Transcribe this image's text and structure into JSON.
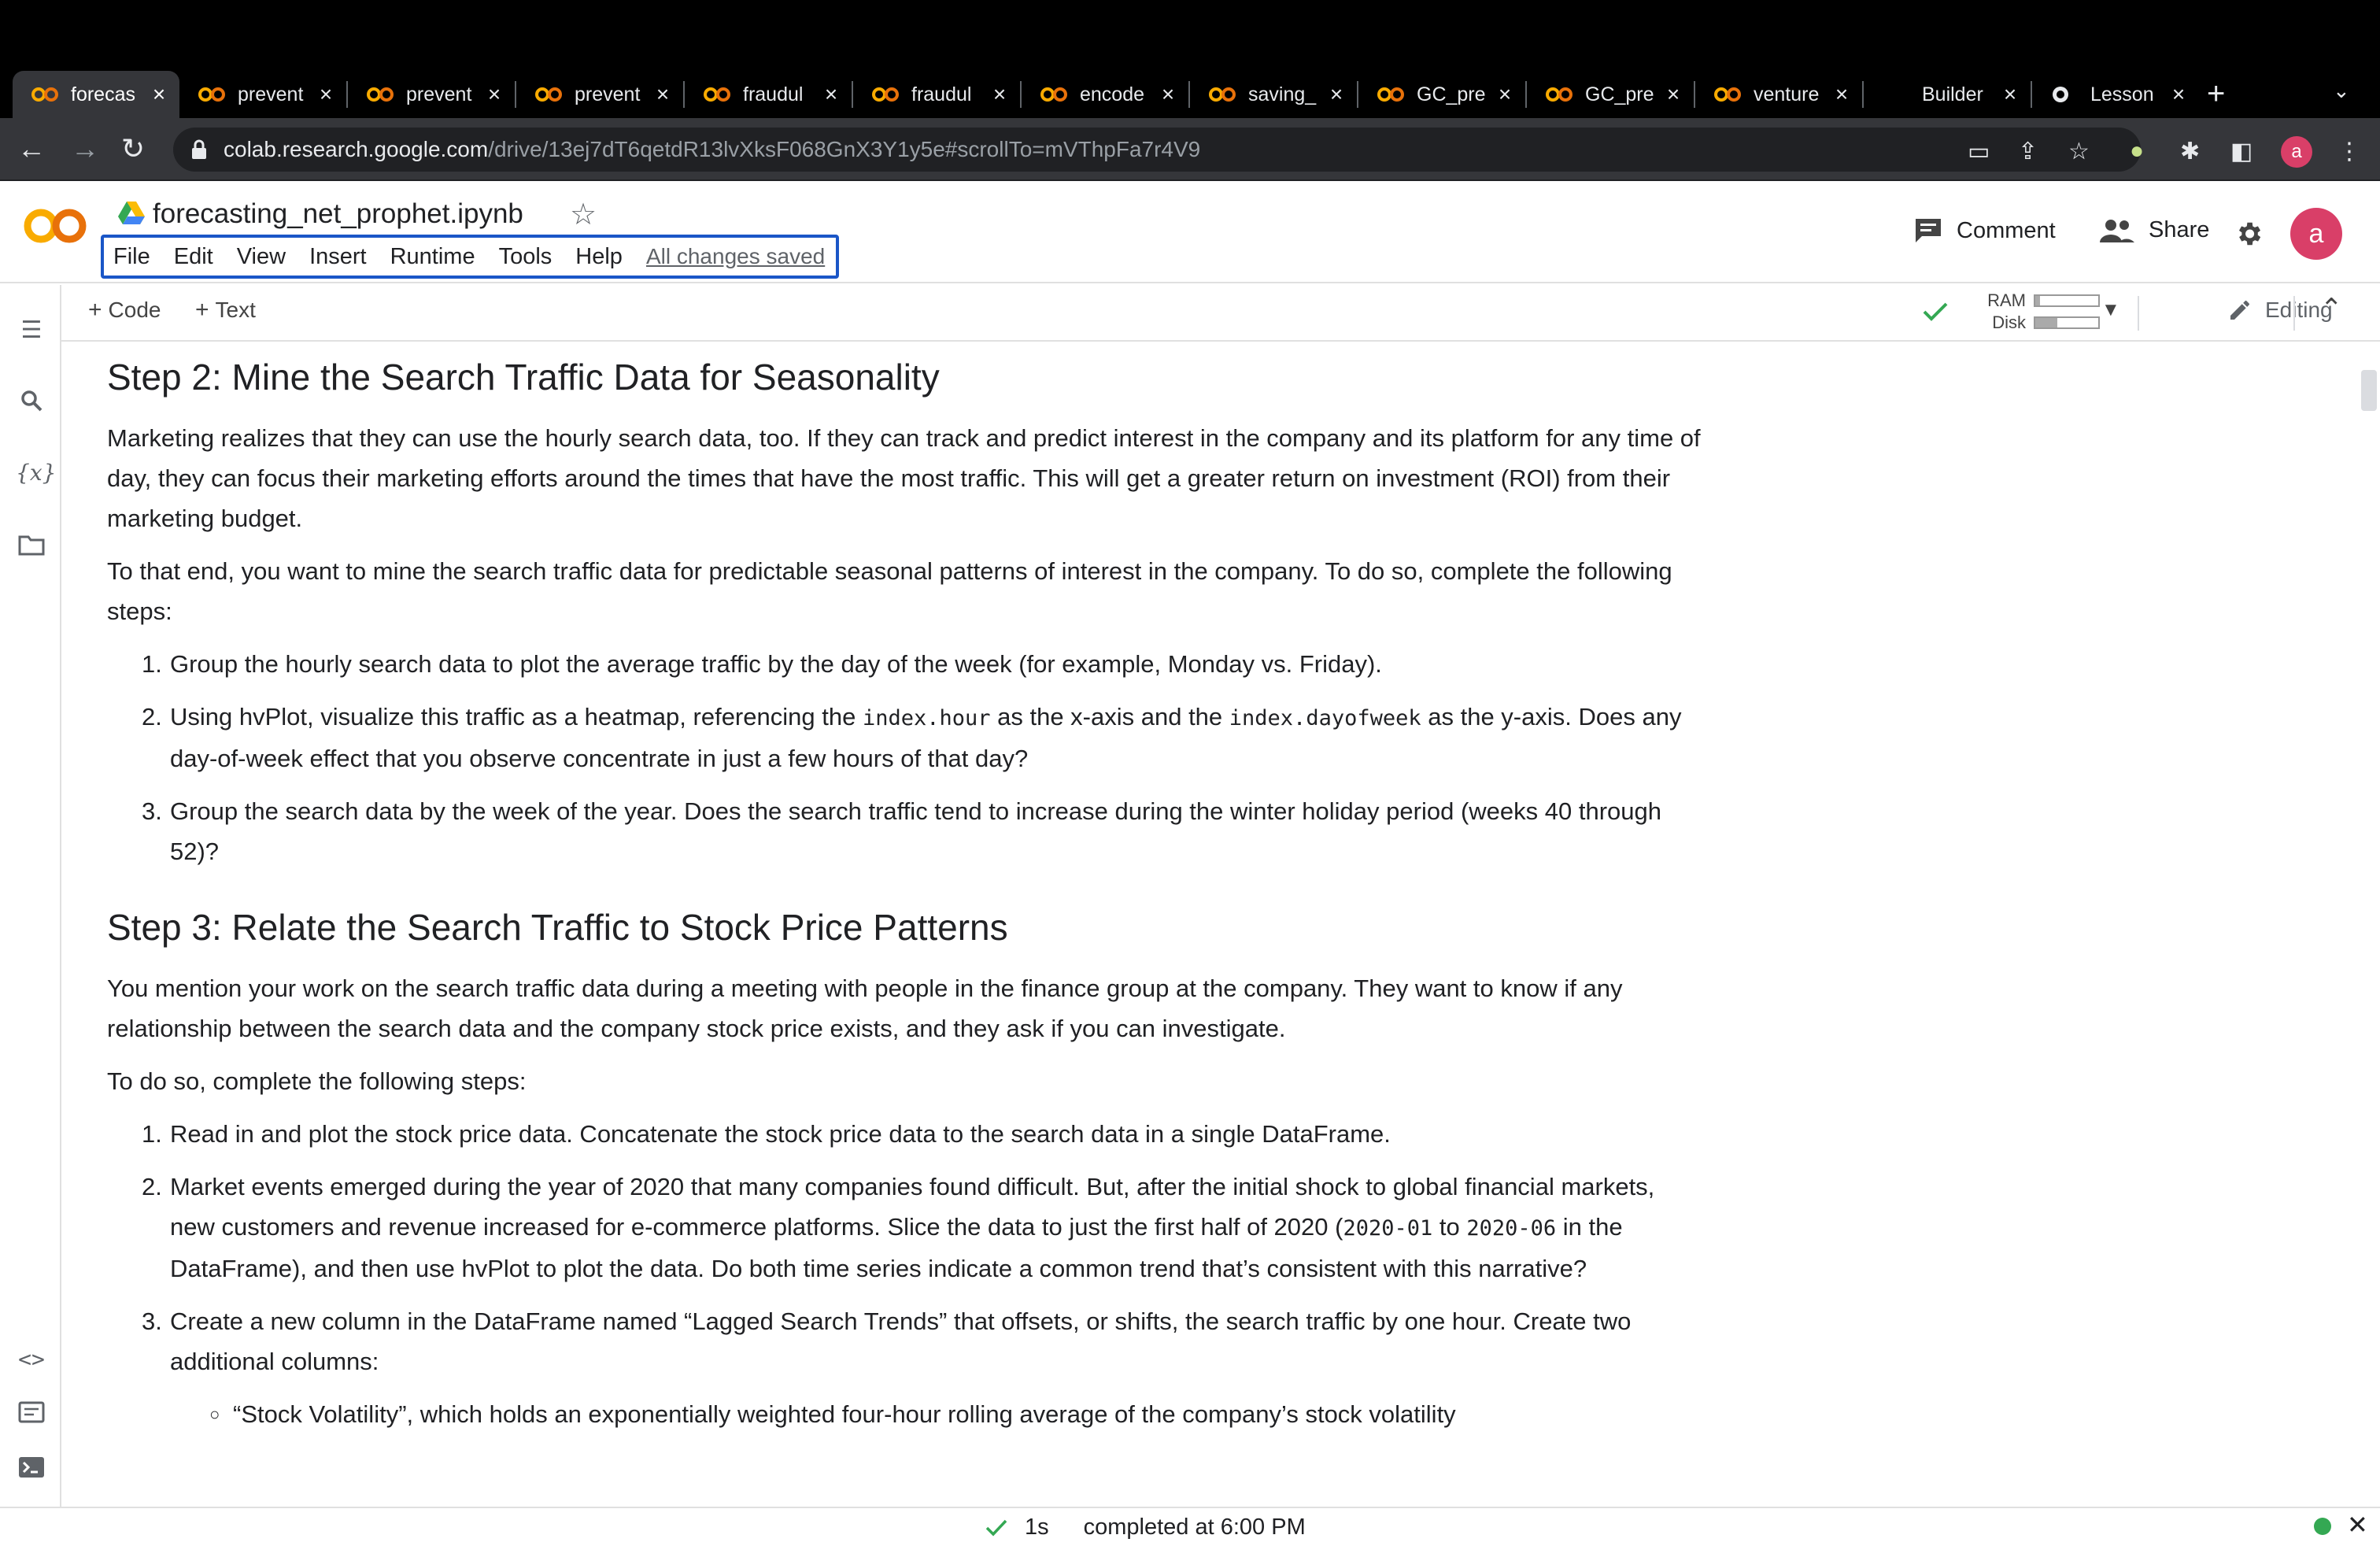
{
  "browser": {
    "tabs": [
      {
        "title": "forecas",
        "active": true
      },
      {
        "title": "prevent"
      },
      {
        "title": "prevent"
      },
      {
        "title": "prevent"
      },
      {
        "title": "fraudul"
      },
      {
        "title": "fraudul"
      },
      {
        "title": "encode"
      },
      {
        "title": "saving_"
      },
      {
        "title": "GC_pre"
      },
      {
        "title": "GC_pre"
      },
      {
        "title": "venture"
      },
      {
        "title": "Builder"
      },
      {
        "title": "Lesson"
      }
    ],
    "url_host": "colab.research.google.com",
    "url_path": "/drive/13ej7dT6qetdR13lvXksF068GnX3Y1y5e#scrollTo=mVThpFa7r4V9",
    "profile_initial": "a"
  },
  "notebook": {
    "title": "forecasting_net_prophet.ipynb",
    "menu": [
      "File",
      "Edit",
      "View",
      "Insert",
      "Runtime",
      "Tools",
      "Help"
    ],
    "save_status": "All changes saved",
    "comment_label": "Comment",
    "share_label": "Share",
    "user_initial": "a"
  },
  "toolbar": {
    "add_code": "Code",
    "add_text": "Text",
    "ram_label": "RAM",
    "disk_label": "Disk",
    "ram_usage": 0.08,
    "disk_usage": 0.35,
    "mode_label": "Editing"
  },
  "content": {
    "step2": {
      "heading": "Step 2: Mine the Search Traffic Data for Seasonality",
      "para1": "Marketing realizes that they can use the hourly search data, too. If they can track and predict interest in the company and its platform for any time of day, they can focus their marketing efforts around the times that have the most traffic. This will get a greater return on investment (ROI) from their marketing budget.",
      "para2": "To that end, you want to mine the search traffic data for predictable seasonal patterns of interest in the company. To do so, complete the following steps:",
      "item1": "Group the hourly search data to plot the average traffic by the day of the week (for example, Monday vs. Friday).",
      "item2_a": "Using hvPlot, visualize this traffic as a heatmap, referencing the ",
      "item2_code1": "index.hour",
      "item2_b": " as the x-axis and the ",
      "item2_code2": "index.dayofweek",
      "item2_c": " as the y-axis. Does any day-of-week effect that you observe concentrate in just a few hours of that day?",
      "item3": "Group the search data by the week of the year. Does the search traffic tend to increase during the winter holiday period (weeks 40 through 52)?"
    },
    "step3": {
      "heading": "Step 3: Relate the Search Traffic to Stock Price Patterns",
      "para1": "You mention your work on the search traffic data during a meeting with people in the finance group at the company. They want to know if any relationship between the search data and the company stock price exists, and they ask if you can investigate.",
      "para2": "To do so, complete the following steps:",
      "item1": "Read in and plot the stock price data. Concatenate the stock price data to the search data in a single DataFrame.",
      "item2_a": "Market events emerged during the year of 2020 that many companies found difficult. But, after the initial shock to global financial markets, new customers and revenue increased for e-commerce platforms. Slice the data to just the first half of 2020 (",
      "item2_code1": "2020-01",
      "item2_b": " to ",
      "item2_code2": "2020-06",
      "item2_c": " in the DataFrame), and then use hvPlot to plot the data. Do both time series indicate a common trend that’s consistent with this narrative?",
      "item3": "Create a new column in the DataFrame named “Lagged Search Trends” that offsets, or shifts, the search traffic by one hour. Create two additional columns:",
      "sub1": "“Stock Volatility”, which holds an exponentially weighted four-hour rolling average of the company’s stock volatility"
    }
  },
  "status": {
    "duration": "1s",
    "message": "completed at 6:00 PM"
  }
}
